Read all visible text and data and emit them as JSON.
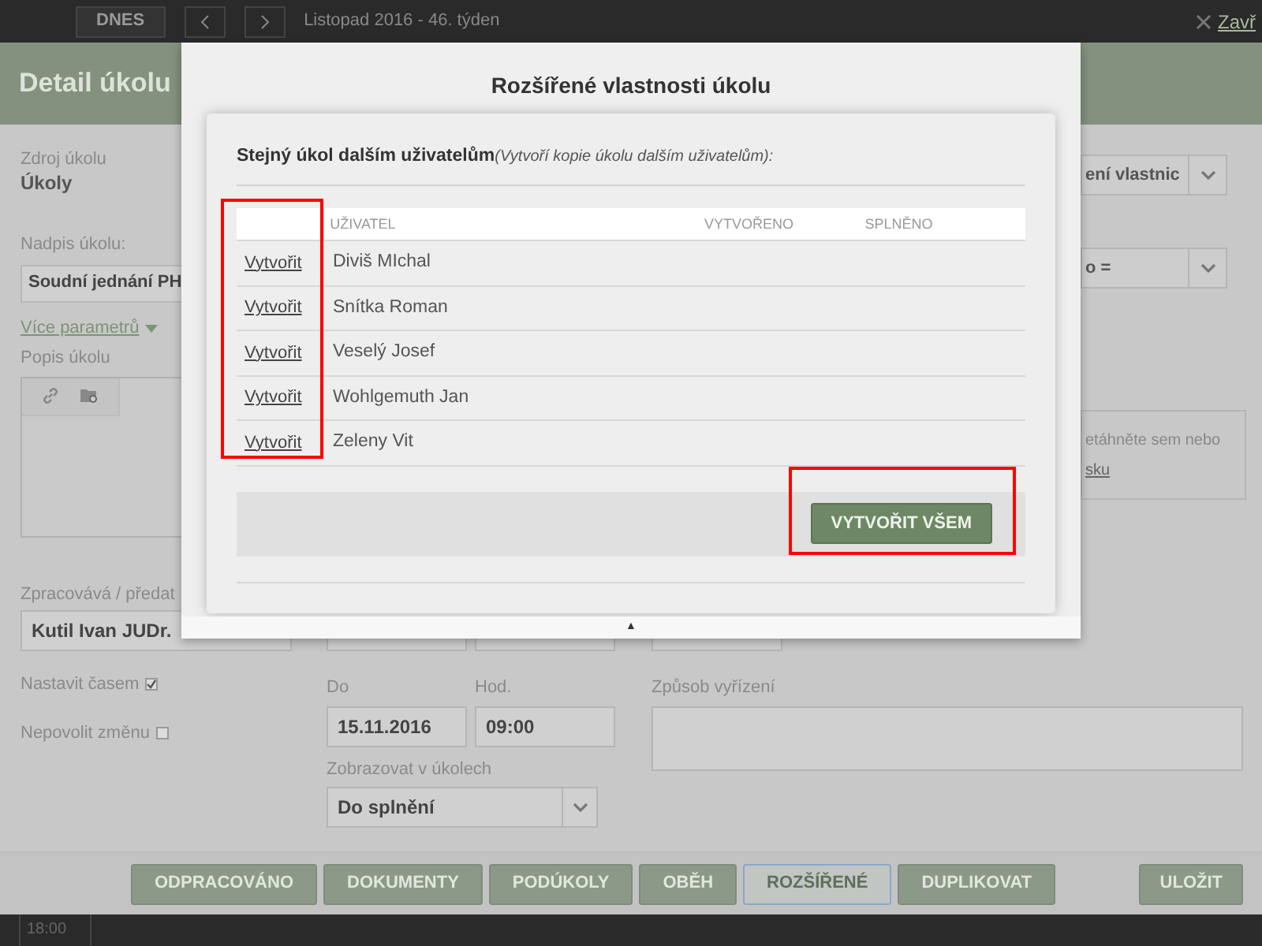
{
  "top_bar": {
    "today_button": "DNES",
    "period": "Listopad 2016 - 46. týden",
    "close_link": "Zavř"
  },
  "panel": {
    "title": "Detail úkolu",
    "source_label": "Zdroj úkolu",
    "source_value": "Úkoly",
    "properties_select": "ení vlastnic",
    "title_label": "Nadpis úkolu:",
    "title_value": "Soudní jednání PH",
    "filter_select": "o =",
    "more_params": "Více parametrů",
    "description_label": "Popis úkolu",
    "dropzone_text": "etáhněte sem nebo",
    "dropzone_link": "sku",
    "assignee_label": "Zpracovává / předat",
    "assignee_value": "Kutil Ivan JUDr.",
    "options": [
      {
        "label": "Nastavit časem",
        "checked": true
      },
      {
        "label": "Nepovolit změnu",
        "checked": false
      }
    ],
    "due_label": "Do",
    "due_date": "15.11.2016",
    "hour_label": "Hod.",
    "due_hour": "09:00",
    "show_label": "Zobrazovat v úkolech",
    "show_value": "Do splnění",
    "resolution_label": "Způsob vyřízení"
  },
  "footer_buttons": [
    {
      "label": "ODPRACOVÁNO",
      "selected": false
    },
    {
      "label": "DOKUMENTY",
      "selected": false
    },
    {
      "label": "PODÚKOLY",
      "selected": false
    },
    {
      "label": "OBĚH",
      "selected": false
    },
    {
      "label": "ROZŠÍŘENÉ",
      "selected": true
    },
    {
      "label": "DUPLIKOVAT",
      "selected": false
    }
  ],
  "save_button": "ULOŽIT",
  "time_label": "18:00",
  "modal": {
    "title": "Rozšířené vlastnosti úkolu",
    "section_heading": "Stejný úkol dalším uživatelům",
    "section_note": "(Vytvoří kopie úkolu dalším uživatelům):",
    "columns": [
      "UŽIVATEL",
      "VYTVOŘENO",
      "SPLNĚNO"
    ],
    "rows": [
      {
        "action": "Vytvořit",
        "user": "Diviš MIchal"
      },
      {
        "action": "Vytvořit",
        "user": "Snítka Roman"
      },
      {
        "action": "Vytvořit",
        "user": "Veselý Josef"
      },
      {
        "action": "Vytvořit",
        "user": "Wohlgemuth Jan"
      },
      {
        "action": "Vytvořit",
        "user": "Zeleny Vit"
      }
    ],
    "create_all_button": "VYTVOŘIT VŠEM",
    "collapse": "▲"
  }
}
